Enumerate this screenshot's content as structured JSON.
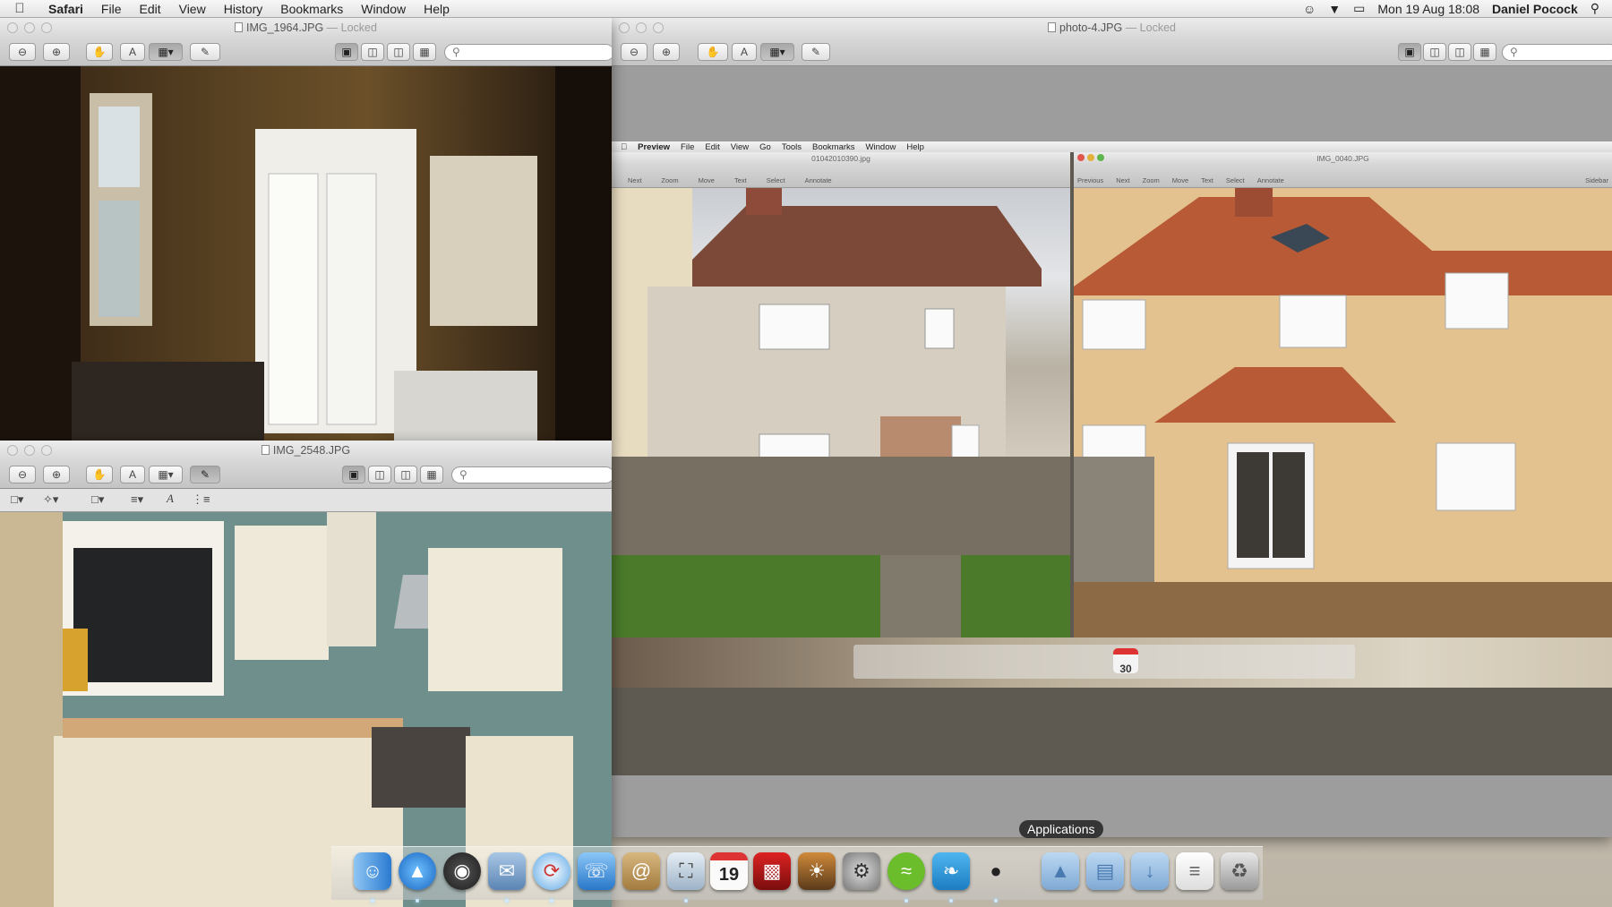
{
  "menubar": {
    "apple": "",
    "app_name": "Safari",
    "items": [
      "File",
      "Edit",
      "View",
      "History",
      "Bookmarks",
      "Window",
      "Help"
    ],
    "clock": "Mon 19 Aug  18:08",
    "user": "Daniel Pocock"
  },
  "windows": {
    "top_left": {
      "title": "IMG_1964.JPG",
      "locked": "— Locked"
    },
    "bottom_left": {
      "title": "IMG_2548.JPG"
    },
    "right": {
      "title": "photo-4.JPG",
      "locked": "— Locked"
    }
  },
  "search": {
    "placeholder": ""
  },
  "inner_screenshot": {
    "menu": [
      "Preview",
      "File",
      "Edit",
      "View",
      "Go",
      "Tools",
      "Bookmarks",
      "Window",
      "Help"
    ],
    "left_title": "01042010390.jpg",
    "right_title": "IMG_0040.JPG",
    "toolbar_labels": [
      "Next",
      "Zoom",
      "Move",
      "Text",
      "Select",
      "Annotate"
    ],
    "right_toolbar_labels": [
      "Previous",
      "Next",
      "Zoom",
      "Move",
      "Text",
      "Select",
      "Annotate",
      "Sidebar"
    ],
    "inner_calendar_day": "30"
  },
  "dock": {
    "tooltip": "Applications",
    "calendar_day": "19",
    "apps": [
      "Finder",
      "App Store",
      "Dashboard",
      "Mail",
      "Safari",
      "FaceTime",
      "Contacts",
      "Preview",
      "Calendar",
      "Photo Booth",
      "iPhoto",
      "System Preferences",
      "Spotify",
      "Twitter",
      "Adium",
      "Applications",
      "Documents",
      "Downloads",
      "Notes",
      "Trash"
    ]
  }
}
